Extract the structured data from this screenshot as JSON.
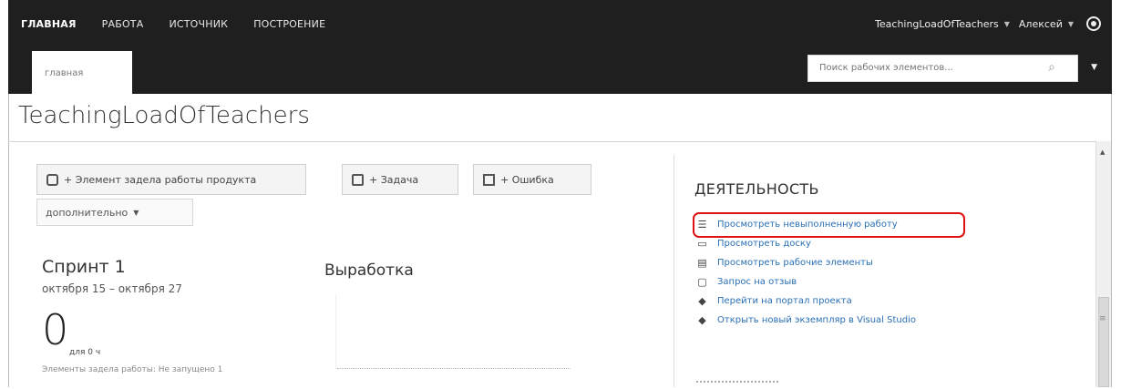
{
  "top_nav": [
    "ГЛАВНАЯ",
    "РАБОТА",
    "ИСТОЧНИК",
    "ПОСТРОЕНИЕ"
  ],
  "project_selector": "TeachingLoadOfTeachers",
  "user": "Алексей",
  "sub_tab": "главная",
  "search_placeholder": "Поиск рабочих элементов...",
  "page_title": "TeachingLoadOfTeachers",
  "buttons": {
    "backlog_item": "+ Элемент задела работы продукта",
    "task": "+ Задача",
    "bug": "+ Ошибка",
    "more": "дополнительно"
  },
  "sprint": {
    "title": "Спринт 1",
    "dates": "октября 15 – октября 27",
    "remaining": "0",
    "for_days": "для 0 ч",
    "items_note": "Элементы задела работы: Не запущено 1"
  },
  "burndown": {
    "title": "Выработка"
  },
  "activity": {
    "heading": "ДЕЯТЕЛЬНОСТЬ",
    "links": [
      "Просмотреть невыполненную работу",
      "Просмотреть доску",
      "Просмотреть рабочие элементы",
      "Запрос на отзыв",
      "Перейти на портал проекта",
      "Открыть новый экземпляр в Visual Studio"
    ]
  },
  "colors": {
    "topbar": "#1f1f1f",
    "link": "#2a6fb4",
    "highlight": "#dd1111"
  },
  "icons": [
    "gear-icon",
    "search-icon",
    "feedback-icon",
    "task-icon",
    "bug-icon",
    "backlog-icon",
    "board-icon",
    "work-items-icon",
    "request-icon",
    "portal-icon",
    "visual-studio-icon"
  ]
}
